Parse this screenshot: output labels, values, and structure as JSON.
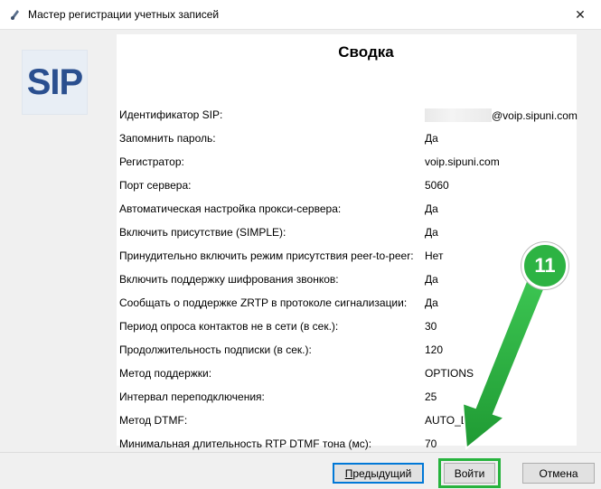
{
  "window": {
    "title": "Мастер регистрации учетных записей",
    "close_glyph": "✕"
  },
  "logo": {
    "text": "SIP"
  },
  "summary": {
    "title": "Сводка",
    "rows": [
      {
        "label": "Идентификатор SIP:",
        "value": "@voip.sipuni.com"
      },
      {
        "label": "Запомнить пароль:",
        "value": "Да"
      },
      {
        "label": "Регистратор:",
        "value": "voip.sipuni.com"
      },
      {
        "label": "Порт сервера:",
        "value": "5060"
      },
      {
        "label": "Автоматическая настройка прокси-сервера:",
        "value": "Да"
      },
      {
        "label": "Включить присутствие (SIMPLE):",
        "value": "Да"
      },
      {
        "label": "Принудительно включить режим присутствия peer-to-peer:",
        "value": "Нет"
      },
      {
        "label": "Включить поддержку шифрования звонков:",
        "value": "Да"
      },
      {
        "label": "Сообщать о поддержке ZRTP в протоколе сигнализации:",
        "value": "Да"
      },
      {
        "label": "Период опроса контактов не в сети (в сек.):",
        "value": "30"
      },
      {
        "label": "Продолжительность подписки (в сек.):",
        "value": "120"
      },
      {
        "label": "Метод поддержки:",
        "value": "OPTIONS"
      },
      {
        "label": "Интервал переподключения:",
        "value": "25"
      },
      {
        "label": "Метод DTMF:",
        "value": "AUTO_DTMF"
      },
      {
        "label": "Минимальная длительность RTP DTMF тона (мс):",
        "value": "70"
      }
    ]
  },
  "buttons": {
    "prev_underlined": "П",
    "prev_rest": "редыдущий",
    "login": "Войти",
    "cancel": "Отмена"
  },
  "annotation": {
    "step_number": "11",
    "color": "#2db343"
  }
}
